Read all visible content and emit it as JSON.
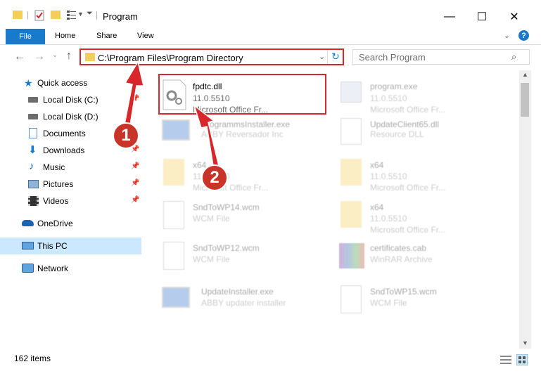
{
  "window": {
    "title": "Program"
  },
  "ribbon": {
    "tabs": [
      "File",
      "Home",
      "Share",
      "View"
    ]
  },
  "address": {
    "path": "C:\\Program Files\\Program Directory"
  },
  "search": {
    "placeholder": "Search Program"
  },
  "sidebar": {
    "items": [
      {
        "label": "Quick access",
        "icon": "star-icon"
      },
      {
        "label": "Local Disk (C:)",
        "icon": "drive-icon"
      },
      {
        "label": "Local Disk (D:)",
        "icon": "drive-icon"
      },
      {
        "label": "Documents",
        "icon": "documents-icon"
      },
      {
        "label": "Downloads",
        "icon": "downloads-icon"
      },
      {
        "label": "Music",
        "icon": "music-icon"
      },
      {
        "label": "Pictures",
        "icon": "pictures-icon"
      },
      {
        "label": "Videos",
        "icon": "videos-icon"
      },
      {
        "label": "OneDrive",
        "icon": "onedrive-icon"
      },
      {
        "label": "This PC",
        "icon": "computer-icon"
      },
      {
        "label": "Network",
        "icon": "network-icon"
      }
    ]
  },
  "files": [
    {
      "name": "fpdtc.dll",
      "line1": "11.0.5510",
      "line2": "Microsoft Office Fr...",
      "icon": "dll-gear-icon"
    },
    {
      "name": "program.exe",
      "line1": "11.0.5510",
      "line2": "Microsoft Office Fr...",
      "icon": "exe-icon"
    },
    {
      "name": "ProgrammsInstaller.exe",
      "line1": "ABBY Reversador Inc",
      "line2": "",
      "icon": "installer-icon"
    },
    {
      "name": "UpdateClient65.dll",
      "line1": "Resource DLL",
      "line2": "",
      "icon": "dll-icon"
    },
    {
      "name": "x64",
      "line1": "11.0.5510",
      "line2": "Microsoft Office Fr...",
      "icon": "folder-icon"
    },
    {
      "name": "x64",
      "line1": "11.0.5510",
      "line2": "Microsoft Office Fr...",
      "icon": "folder-icon"
    },
    {
      "name": "SndToWP14.wcm",
      "line1": "WCM File",
      "line2": "",
      "icon": "file-icon"
    },
    {
      "name": "x64",
      "line1": "11.0.5510",
      "line2": "Microsoft Office Fr...",
      "icon": "folder-icon"
    },
    {
      "name": "SndToWP12.wcm",
      "line1": "WCM File",
      "line2": "",
      "icon": "file-icon"
    },
    {
      "name": "certificates.cab",
      "line1": "WinRAR Archive",
      "line2": "",
      "icon": "archive-icon"
    },
    {
      "name": "UpdateInstaller.exe",
      "line1": "ABBY updater installer",
      "line2": "",
      "icon": "installer-icon"
    },
    {
      "name": "SndToWP15.wcm",
      "line1": "WCM File",
      "line2": "",
      "icon": "file-icon"
    }
  ],
  "status": {
    "count": "162 items"
  },
  "callouts": [
    "1",
    "2"
  ],
  "colors": {
    "accent": "#1979ca",
    "highlight": "#d8272b",
    "callout": "#c8332a",
    "selected": "#cce8ff"
  }
}
